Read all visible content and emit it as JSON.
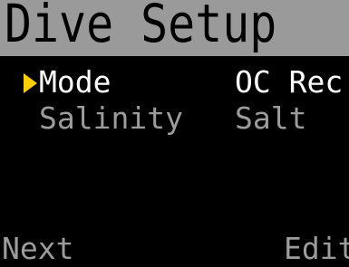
{
  "header": {
    "title": "Dive Setup"
  },
  "menu": {
    "items": [
      {
        "label": "Mode",
        "value": "OC Rec",
        "selected": true
      },
      {
        "label": "Salinity",
        "value": "Salt",
        "selected": false
      }
    ],
    "cursor_icon": "triangle-right-icon"
  },
  "softkeys": {
    "left_label": "Next",
    "right_label": "Edit"
  },
  "colors": {
    "background": "#000000",
    "title_bar": "#9a9a9a",
    "title_text": "#000000",
    "selected_text": "#ffffff",
    "unselected_text": "#9c9c9c",
    "cursor": "#ffd000"
  }
}
